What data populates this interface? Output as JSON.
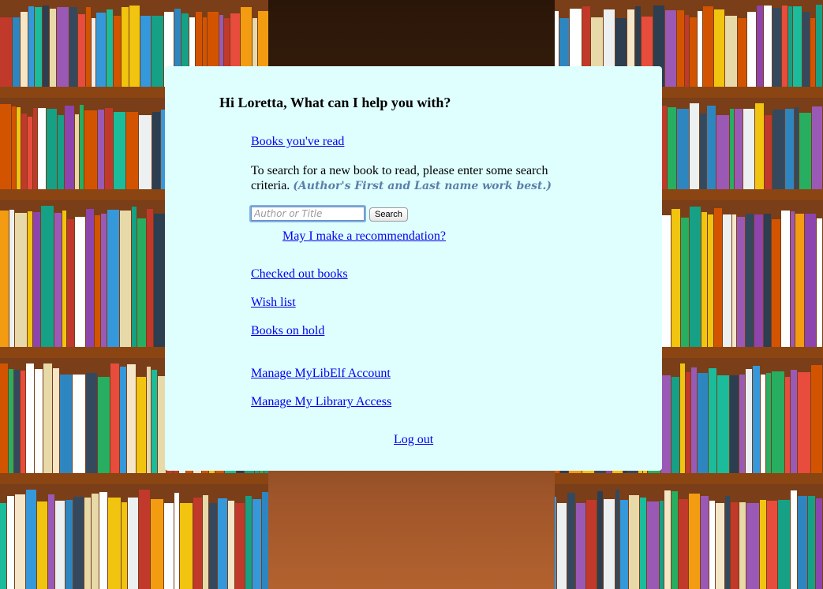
{
  "greeting": "Hi Loretta, What can I help you with?",
  "links": {
    "books_read": "Books you've read",
    "recommendation": "May I make a recommendation?",
    "checked_out": "Checked out books",
    "wish_list": "Wish list",
    "books_on_hold": "Books on hold",
    "manage_account": "Manage MyLibElf Account",
    "manage_library_access": "Manage My Library Access",
    "log_out": "Log out"
  },
  "search": {
    "instruction": "To search for a new book to read, please enter some search criteria.",
    "hint": "(Author's First and Last name work best.)",
    "placeholder": "Author or Title",
    "value": "",
    "button_label": "Search"
  },
  "colors": {
    "panel_background": "#dfffff",
    "link": "#0000ee",
    "hint": "#5b7fa8"
  }
}
